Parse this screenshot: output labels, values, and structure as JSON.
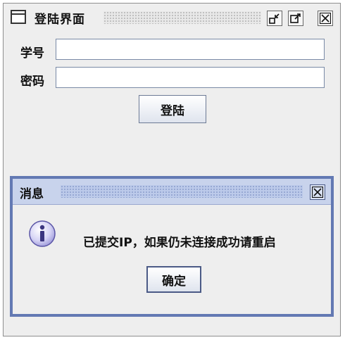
{
  "window": {
    "title": "登陆界面"
  },
  "form": {
    "student_id_label": "学号",
    "student_id_value": "",
    "password_label": "密码",
    "password_value": "",
    "login_label": "登陆"
  },
  "dialog": {
    "title": "消息",
    "message": "已提交IP，如果仍未连接成功请重启",
    "ok_label": "确定"
  },
  "icons": {
    "window": "window-icon",
    "minimize": "minimize-icon",
    "maximize": "maximize-icon",
    "close": "close-icon",
    "info": "info-icon"
  },
  "colors": {
    "dialog_border": "#6379b3",
    "dialog_title_bg": "#c8d3ec",
    "window_bg": "#eeeeee"
  }
}
